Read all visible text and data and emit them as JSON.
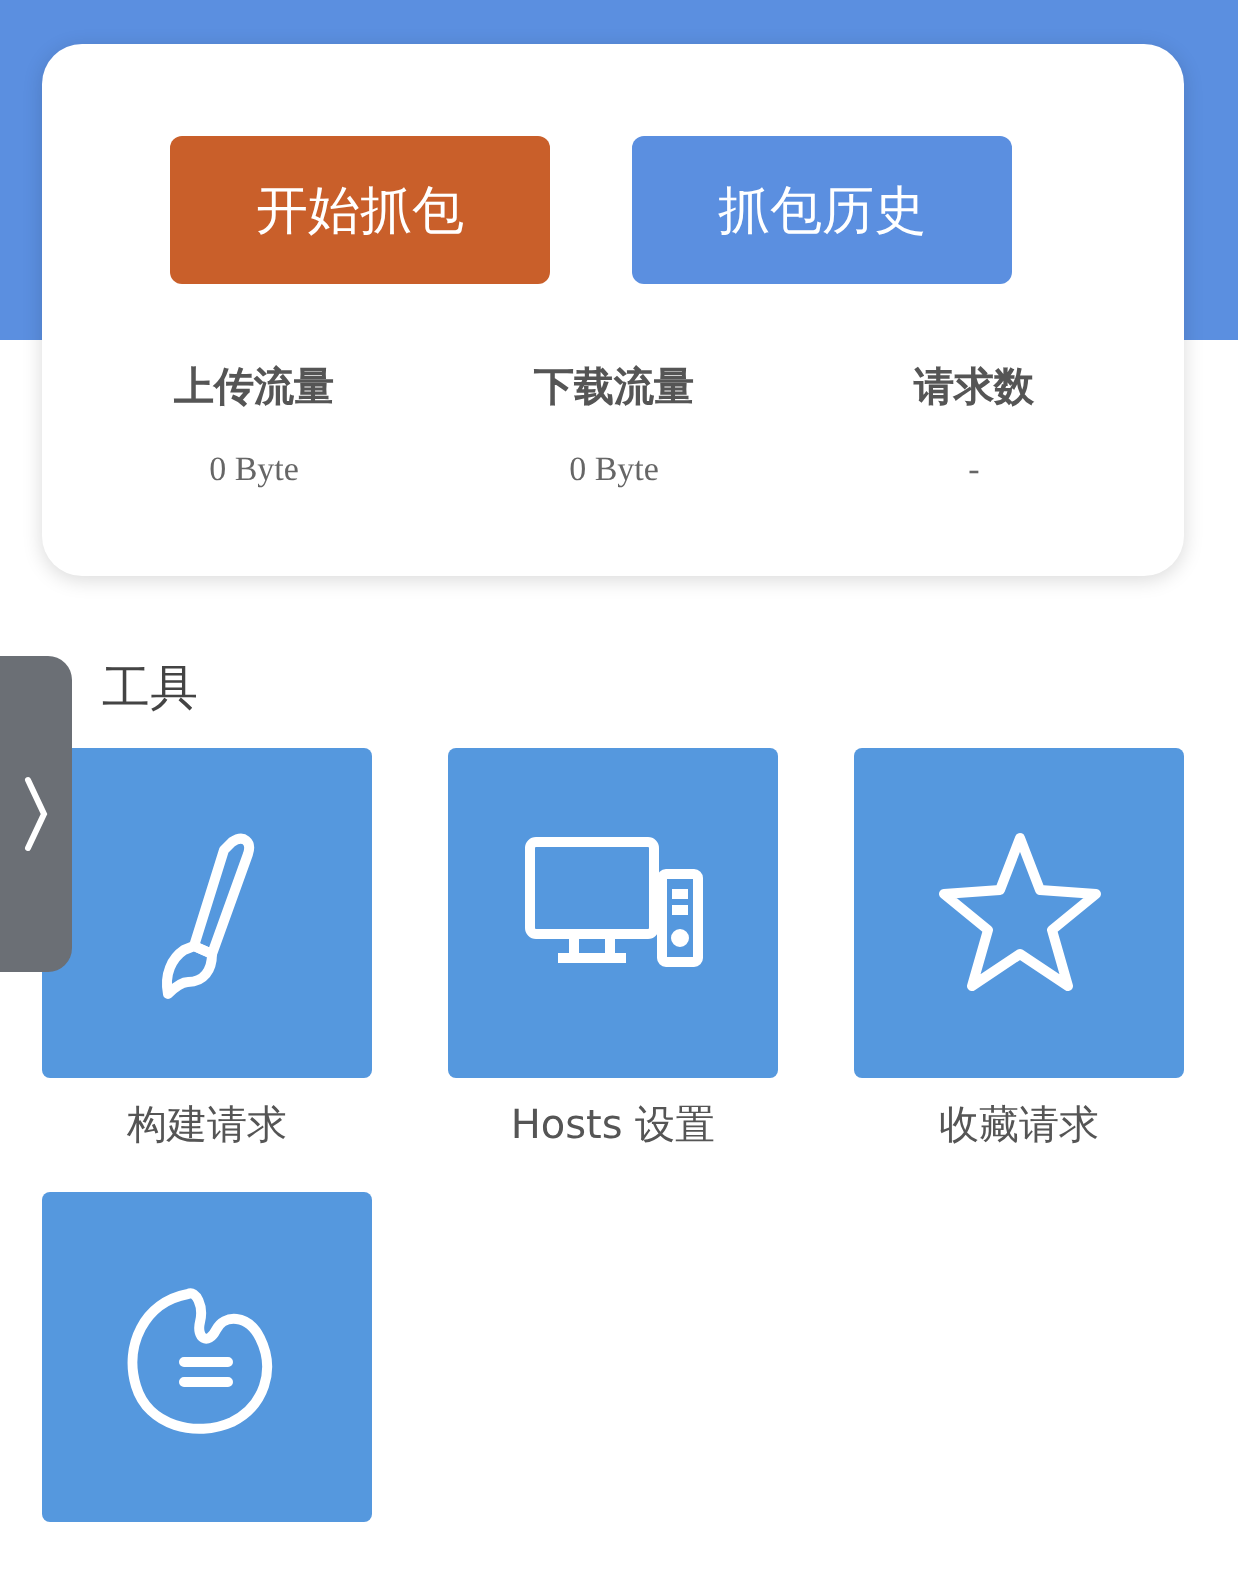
{
  "actions": [
    {
      "label": "开始抓包",
      "kind": "primary"
    },
    {
      "label": "抓包历史",
      "kind": "secondary"
    }
  ],
  "stats": [
    {
      "label": "上传流量",
      "value": "0 Byte"
    },
    {
      "label": "下载流量",
      "value": "0 Byte"
    },
    {
      "label": "请求数",
      "value": "-"
    }
  ],
  "tools_title": "工具",
  "tools": [
    {
      "kind": "labeled",
      "label": "构建请求"
    },
    {
      "kind": "labeled",
      "label": "Hosts 设置"
    },
    {
      "kind": "labeled",
      "label": "收藏请求"
    },
    {
      "kind": "icon-only"
    }
  ]
}
